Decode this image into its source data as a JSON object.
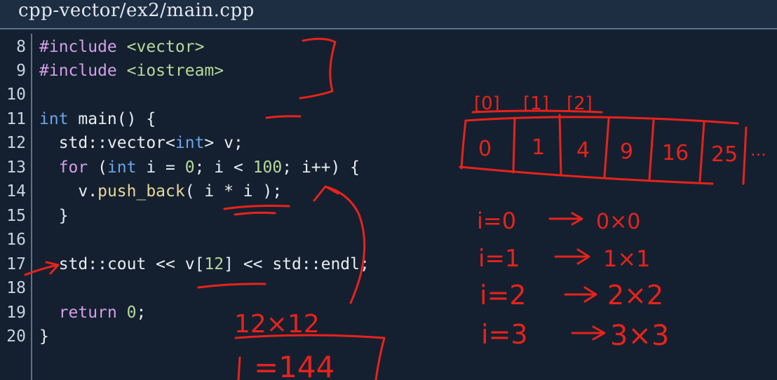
{
  "window": {
    "title": "cpp-vector/ex2/main.cpp"
  },
  "editor": {
    "line_numbers": [
      "8",
      "9",
      "10",
      "11",
      "12",
      "13",
      "14",
      "15",
      "16",
      "17",
      "18",
      "19",
      "20"
    ],
    "code": {
      "l8": {
        "directive": "#include",
        "header": "<vector>"
      },
      "l9": {
        "directive": "#include",
        "header": "<iostream>"
      },
      "l11": {
        "type": "int",
        "rest": " main() {"
      },
      "l12": {
        "a": "std::vector<",
        "type": "int",
        "b": "> v;"
      },
      "l13": {
        "kw": "for",
        "a": " (",
        "type": "int",
        "b": " i = ",
        "n1": "0",
        "c": "; i < ",
        "n2": "100",
        "d": "; i++) {"
      },
      "l14": {
        "a": "v.",
        "fn": "push_back",
        "b": "( i * i );"
      },
      "l15": {
        "text": "}"
      },
      "l17": {
        "a": "std::cout << v[",
        "n": "12",
        "b": "] << std::endl;"
      },
      "l19": {
        "kw": "return",
        "a": " ",
        "n": "0",
        "b": ";"
      },
      "l20": {
        "text": "}"
      }
    }
  },
  "annotations": {
    "ink_color": "#e8221c",
    "vector_indices": [
      "[0]",
      "[1]",
      "[2]"
    ],
    "vector_cells": [
      "0",
      "1",
      "4",
      "9",
      "16",
      "25"
    ],
    "vector_ellipsis": "...",
    "iterations": [
      {
        "lhs": "i=0",
        "arrow": "→",
        "rhs": "0×0"
      },
      {
        "lhs": "i=1",
        "arrow": "→",
        "rhs": "1×1"
      },
      {
        "lhs": "i=2",
        "arrow": "→",
        "rhs": "2×2"
      },
      {
        "lhs": "i=3",
        "arrow": "→",
        "rhs": "3×3"
      }
    ],
    "calc_line1": "12×12",
    "calc_line2": "=144"
  }
}
